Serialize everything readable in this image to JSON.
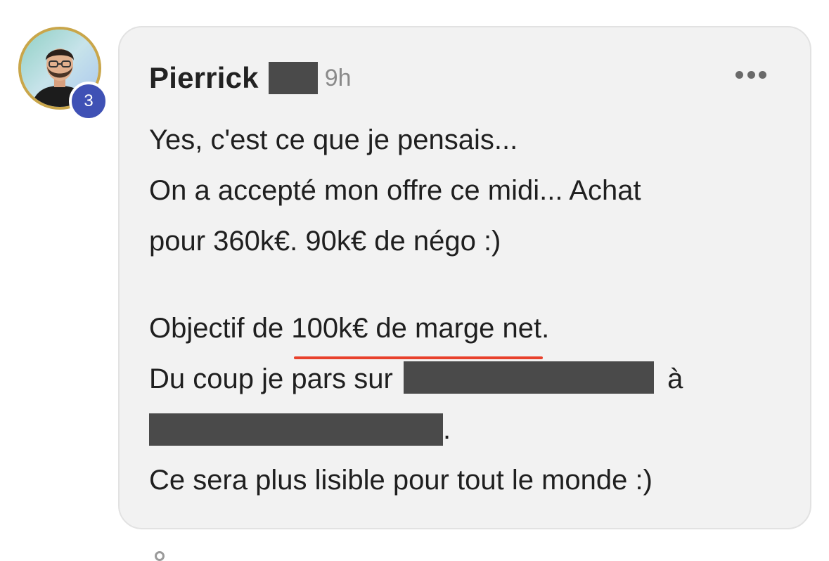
{
  "comment": {
    "author": "Pierrick",
    "time": "9h",
    "badge_count": "3",
    "menu_icon": "more-horizontal-icon",
    "avatar_icon": "user-avatar-photo",
    "lines": {
      "l1": "Yes, c'est ce que je pensais...",
      "l2": "On a accepté mon offre ce midi... Achat",
      "l3": "pour 360k€. 90k€ de négo :)",
      "l4_prefix": "Objectif de ",
      "l4_underlined": "100k€ de marge net",
      "l4_suffix": ".",
      "l5_prefix": "Du coup je pars sur",
      "l5_suffix": "à",
      "l6_suffix": ".",
      "l7": "Ce sera plus lisible pour tout le monde :)"
    }
  },
  "colors": {
    "bubble_bg": "#f2f2f2",
    "badge_bg": "#3f51b5",
    "underline": "#e8412c",
    "redaction": "#4a4a4a",
    "avatar_ring": "#c9a64a"
  }
}
